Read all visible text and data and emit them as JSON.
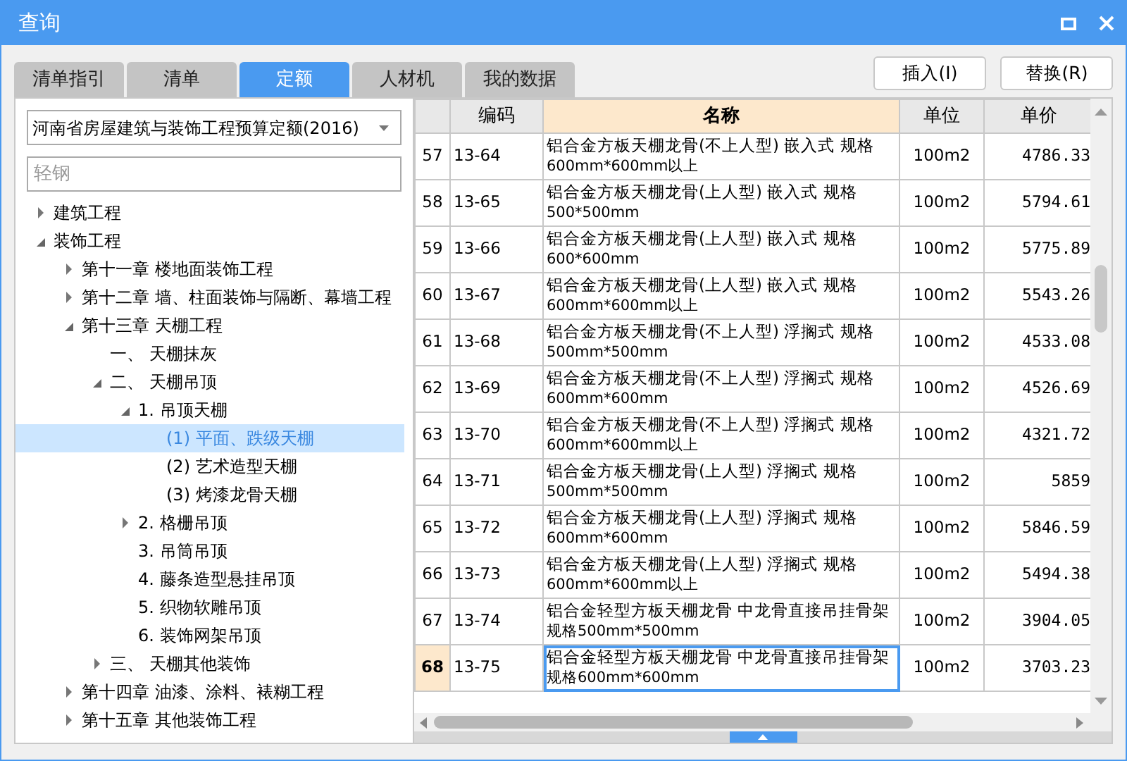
{
  "window": {
    "title": "查询"
  },
  "tabs": [
    {
      "label": "清单指引",
      "selected": false
    },
    {
      "label": "清单",
      "selected": false
    },
    {
      "label": "定额",
      "selected": true
    },
    {
      "label": "人材机",
      "selected": false
    },
    {
      "label": "我的数据",
      "selected": false
    }
  ],
  "buttons": [
    "插入(I)",
    "替换(R)"
  ],
  "library_select": {
    "value": "河南省房屋建筑与装饰工程预算定额(2016)"
  },
  "search": {
    "placeholder": "轻钢"
  },
  "tree": [
    {
      "label": "建筑工程",
      "expanded": false,
      "selected": false
    },
    {
      "label": "装饰工程",
      "expanded": true,
      "selected": false,
      "children": [
        {
          "label": "第十一章 楼地面装饰工程",
          "expanded": false,
          "selected": false
        },
        {
          "label": "第十二章 墙、柱面装饰与隔断、幕墙工程",
          "expanded": false,
          "selected": false
        },
        {
          "label": "第十三章 天棚工程",
          "expanded": true,
          "selected": false,
          "children": [
            {
              "label": "一、 天棚抹灰",
              "selected": false
            },
            {
              "label": "二、 天棚吊顶",
              "expanded": true,
              "selected": false,
              "children": [
                {
                  "label": "1. 吊顶天棚",
                  "expanded": true,
                  "selected": false,
                  "children": [
                    {
                      "label": "(1) 平面、跌级天棚",
                      "selected": true
                    },
                    {
                      "label": "(2) 艺术造型天棚",
                      "selected": false
                    },
                    {
                      "label": "(3) 烤漆龙骨天棚",
                      "selected": false
                    }
                  ]
                },
                {
                  "label": "2. 格栅吊顶",
                  "expanded": false,
                  "selected": false
                },
                {
                  "label": "3. 吊筒吊顶",
                  "selected": false
                },
                {
                  "label": "4. 藤条造型悬挂吊顶",
                  "selected": false
                },
                {
                  "label": "5. 织物软雕吊顶",
                  "selected": false
                },
                {
                  "label": "6. 装饰网架吊顶",
                  "selected": false
                }
              ]
            },
            {
              "label": "三、 天棚其他装饰",
              "expanded": false,
              "selected": false
            }
          ]
        },
        {
          "label": "第十四章 油漆、涂料、裱糊工程",
          "expanded": false,
          "selected": false
        },
        {
          "label": "第十五章 其他装饰工程",
          "expanded": false,
          "selected": false
        }
      ]
    }
  ],
  "table": {
    "columns": [
      "编码",
      "名称",
      "单位",
      "单价"
    ],
    "rows": [
      {
        "number": "57",
        "code": "13-64",
        "name": [
          "铝合金方板天棚龙骨(不上人型) 嵌入式 规格",
          "600mm*600mm以上"
        ],
        "unit": "100m2",
        "price": "4786.33",
        "selected": false
      },
      {
        "number": "58",
        "code": "13-65",
        "name": [
          "铝合金方板天棚龙骨(上人型) 嵌入式 规格",
          "500*500mm"
        ],
        "unit": "100m2",
        "price": "5794.61",
        "selected": false
      },
      {
        "number": "59",
        "code": "13-66",
        "name": [
          "铝合金方板天棚龙骨(上人型) 嵌入式 规格",
          "600*600mm"
        ],
        "unit": "100m2",
        "price": "5775.89",
        "selected": false
      },
      {
        "number": "60",
        "code": "13-67",
        "name": [
          "铝合金方板天棚龙骨(上人型) 嵌入式 规格",
          "600mm*600mm以上"
        ],
        "unit": "100m2",
        "price": "5543.26",
        "selected": false
      },
      {
        "number": "61",
        "code": "13-68",
        "name": [
          "铝合金方板天棚龙骨(不上人型) 浮搁式 规格",
          "500mm*500mm"
        ],
        "unit": "100m2",
        "price": "4533.08",
        "selected": false
      },
      {
        "number": "62",
        "code": "13-69",
        "name": [
          "铝合金方板天棚龙骨(不上人型) 浮搁式 规格",
          "600mm*600mm"
        ],
        "unit": "100m2",
        "price": "4526.69",
        "selected": false
      },
      {
        "number": "63",
        "code": "13-70",
        "name": [
          "铝合金方板天棚龙骨(不上人型) 浮搁式 规格",
          "600mm*600mm以上"
        ],
        "unit": "100m2",
        "price": "4321.72",
        "selected": false
      },
      {
        "number": "64",
        "code": "13-71",
        "name": [
          "铝合金方板天棚龙骨(上人型) 浮搁式 规格",
          "500mm*500mm"
        ],
        "unit": "100m2",
        "price": "5859",
        "selected": false
      },
      {
        "number": "65",
        "code": "13-72",
        "name": [
          "铝合金方板天棚龙骨(上人型) 浮搁式 规格",
          "600mm*600mm"
        ],
        "unit": "100m2",
        "price": "5846.59",
        "selected": false
      },
      {
        "number": "66",
        "code": "13-73",
        "name": [
          "铝合金方板天棚龙骨(上人型) 浮搁式 规格",
          "600mm*600mm以上"
        ],
        "unit": "100m2",
        "price": "5494.38",
        "selected": false
      },
      {
        "number": "67",
        "code": "13-74",
        "name": [
          "铝合金轻型方板天棚龙骨 中龙骨直接吊挂骨架",
          "规格500mm*500mm"
        ],
        "unit": "100m2",
        "price": "3904.05",
        "selected": false
      },
      {
        "number": "68",
        "code": "13-75",
        "name": [
          "铝合金轻型方板天棚龙骨 中龙骨直接吊挂骨架",
          "规格600mm*600mm"
        ],
        "unit": "100m2",
        "price": "3703.23",
        "selected": true
      }
    ]
  }
}
